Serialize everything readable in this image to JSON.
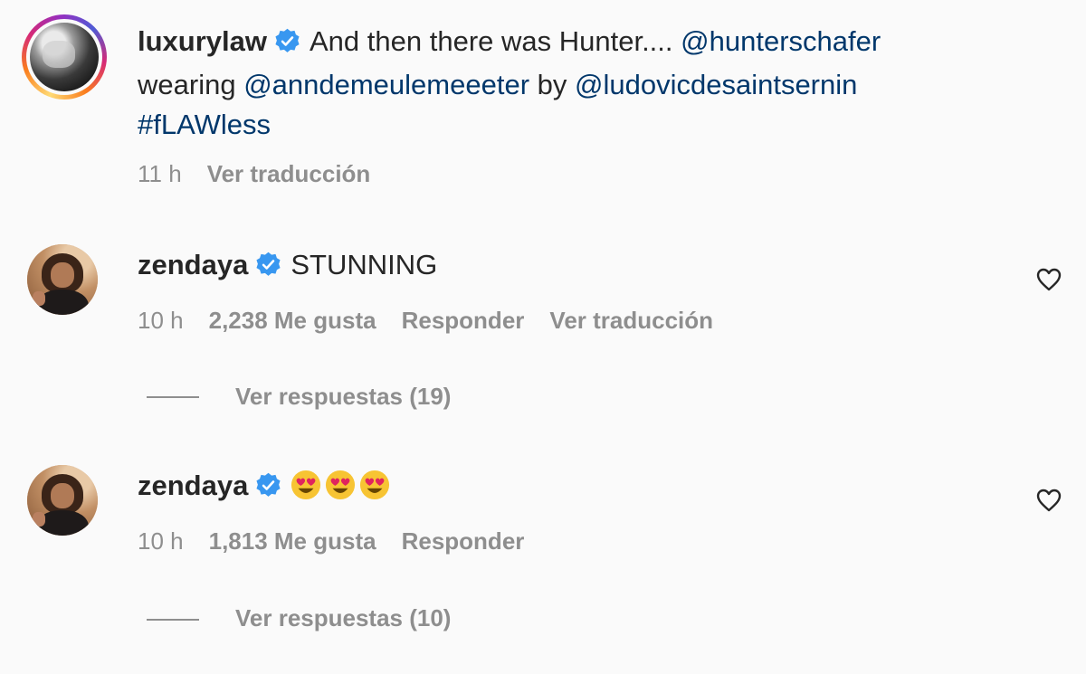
{
  "caption": {
    "username": "luxurylaw",
    "verified_icon": "verified-badge-icon",
    "text_part1": "And then there was Hunter....",
    "mention1": "@hunterschafer",
    "text_part2": "wearing",
    "mention2": "@anndemeulemeeeter",
    "text_part3": "by",
    "mention3": "@ludovicdesaintsernin",
    "hashtag": "#fLAWless",
    "time": "11 h",
    "translate": "Ver traducción"
  },
  "comments": [
    {
      "username": "zendaya",
      "text": "STUNNING",
      "time": "10 h",
      "likes": "2,238 Me gusta",
      "reply": "Responder",
      "translate": "Ver traducción",
      "replies": "Ver respuestas (19)"
    },
    {
      "username": "zendaya",
      "emoji": "heart-eyes-emoji ×3",
      "time": "10 h",
      "likes": "1,813 Me gusta",
      "reply": "Responder",
      "replies": "Ver respuestas (10)"
    }
  ],
  "colors": {
    "text": "#262626",
    "mention": "#00376b",
    "secondary": "#8e8e8e",
    "verified": "#3897f0"
  }
}
